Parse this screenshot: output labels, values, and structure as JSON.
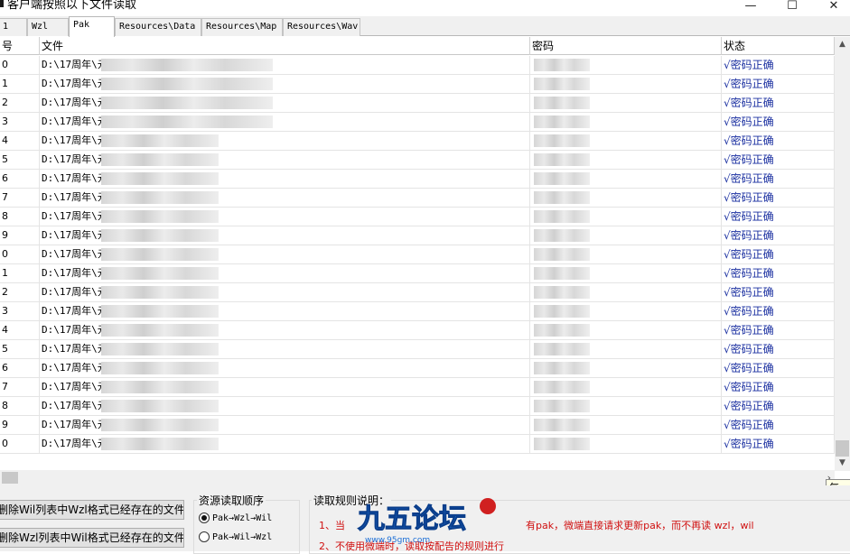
{
  "window": {
    "title": "客户端按照以下文件读取",
    "minimize": "—",
    "maximize": "☐",
    "close": "✕"
  },
  "tabs": [
    {
      "label": "1"
    },
    {
      "label": "Wzl"
    },
    {
      "label": "Pak"
    },
    {
      "label": "Resources\\Data"
    },
    {
      "label": "Resources\\Map"
    },
    {
      "label": "Resources\\Wav"
    }
  ],
  "active_tab": "Pak",
  "table": {
    "columns": [
      "号",
      "文件",
      "密码",
      "状态"
    ],
    "rows": [
      {
        "idx": "0",
        "file": "D:\\17周年\\元",
        "status": "√密码正确"
      },
      {
        "idx": "1",
        "file": "D:\\17周年\\元",
        "status": "√密码正确"
      },
      {
        "idx": "2",
        "file": "D:\\17周年\\元",
        "status": "√密码正确"
      },
      {
        "idx": "3",
        "file": "D:\\17周年\\元",
        "status": "√密码正确"
      },
      {
        "idx": "4",
        "file": "D:\\17周年\\元",
        "status": "√密码正确"
      },
      {
        "idx": "5",
        "file": "D:\\17周年\\元",
        "status": "√密码正确"
      },
      {
        "idx": "6",
        "file": "D:\\17周年\\元",
        "status": "√密码正确"
      },
      {
        "idx": "7",
        "file": "D:\\17周年\\元",
        "status": "√密码正确"
      },
      {
        "idx": "8",
        "file": "D:\\17周年\\元",
        "status": "√密码正确"
      },
      {
        "idx": "9",
        "file": "D:\\17周年\\元",
        "status": "√密码正确"
      },
      {
        "idx": "0",
        "file": "D:\\17周年\\元",
        "status": "√密码正确"
      },
      {
        "idx": "1",
        "file": "D:\\17周年\\元",
        "status": "√密码正确"
      },
      {
        "idx": "2",
        "file": "D:\\17周年\\元",
        "status": "√密码正确"
      },
      {
        "idx": "3",
        "file": "D:\\17周年\\元",
        "status": "√密码正确"
      },
      {
        "idx": "4",
        "file": "D:\\17周年\\元",
        "status": "√密码正确"
      },
      {
        "idx": "5",
        "file": "D:\\17周年\\元",
        "status": "√密码正确"
      },
      {
        "idx": "6",
        "file": "D:\\17周年\\元",
        "status": "√密码正确"
      },
      {
        "idx": "7",
        "file": "D:\\17周年\\元",
        "status": "√密码正确"
      },
      {
        "idx": "8",
        "file": "D:\\17周年\\元",
        "status": "√密码正确"
      },
      {
        "idx": "9",
        "file": "D:\\17周年\\元",
        "status": "√密码正确"
      },
      {
        "idx": "0",
        "file": "D:\\17周年\\元",
        "status": "√密码正确"
      }
    ]
  },
  "tooltip": "每一",
  "buttons": {
    "delete_wil": "删除Wil列表中Wzl格式已经存在的文件",
    "delete_wzl": "删除Wzl列表中Wil格式已经存在的文件"
  },
  "order_group": {
    "label": "资源读取顺序",
    "options": [
      "Pak→Wzl→Wil",
      "Pak→Wil→Wzl"
    ],
    "selected_index": 0
  },
  "rules_group": {
    "label": "读取规则说明：",
    "line1_prefix": "1、当",
    "line1_suffix": "有pak，微端直接请求更新pak，而不再读 wzl，wil",
    "line2": "2、不使用微端时，读取按配告的规则进行"
  },
  "logo": {
    "text": "九五论坛",
    "url": "www.95gm.com"
  }
}
